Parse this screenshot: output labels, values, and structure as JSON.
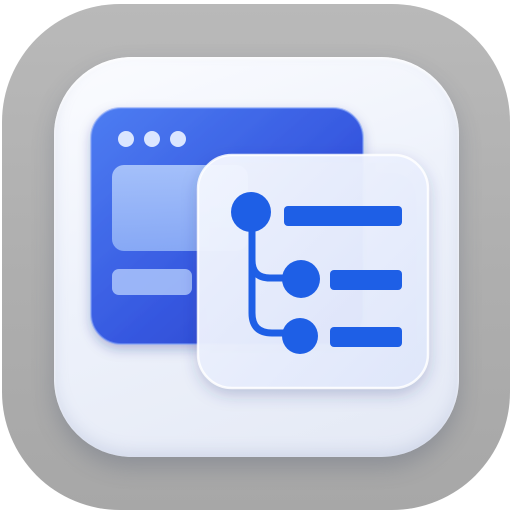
{
  "icon": {
    "name": "app-icon",
    "depicts": [
      "browser-window-icon",
      "tree-structure-icon"
    ],
    "colors": {
      "outer_frame": "#b0b0b0",
      "tile": "#eef2fb",
      "window_primary": "#3a63e8",
      "window_dark": "#2a45c9",
      "tree_accent": "#1e5fe6",
      "card": "#e9effc"
    },
    "tree": {
      "nodes": 3,
      "rows": 3
    },
    "window_dots": 3
  }
}
